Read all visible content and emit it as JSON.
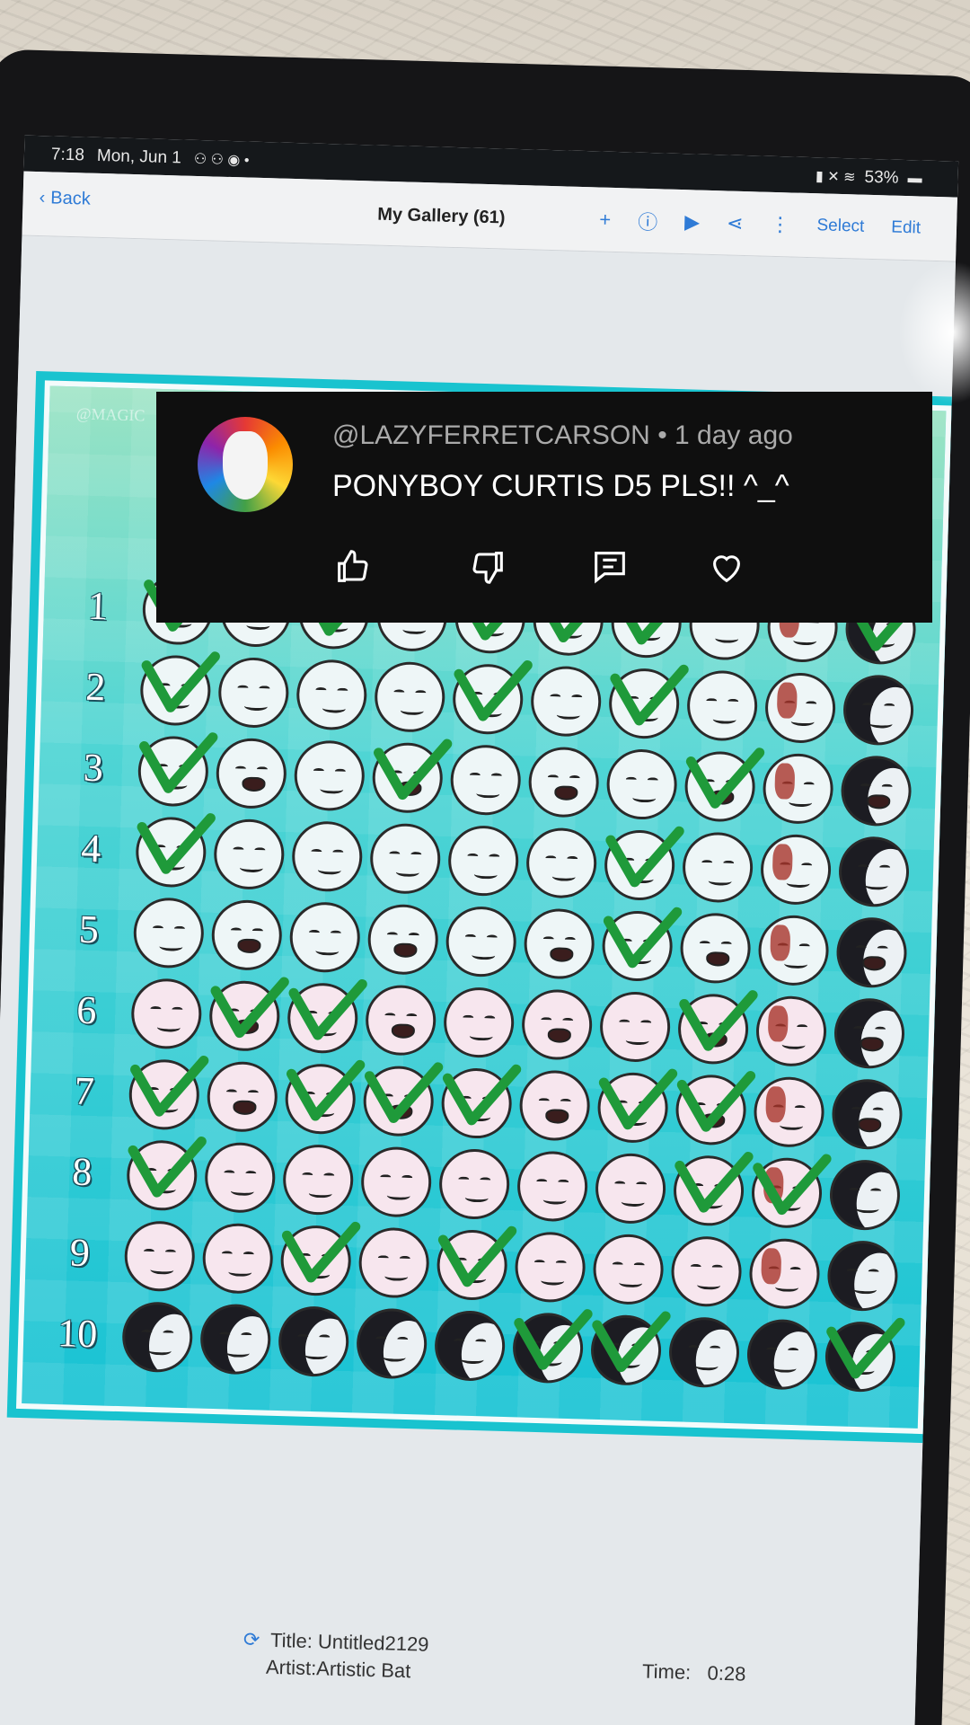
{
  "status_bar": {
    "time": "7:18",
    "date": "Mon, Jun 1",
    "battery": "53%"
  },
  "app_bar": {
    "back_label": "Back",
    "title": "My Gallery (61)",
    "select_label": "Select",
    "edit_label": "Edit",
    "icons": [
      "plus-icon",
      "info-icon",
      "play-icon",
      "share-icon",
      "more-icon"
    ]
  },
  "artwork": {
    "watermark": "@MAGIC",
    "row_numbers": [
      "1",
      "2",
      "3",
      "4",
      "5",
      "6",
      "7",
      "8",
      "9",
      "10"
    ]
  },
  "comment": {
    "handle": "@LAZYFERRETCARSON",
    "age": "1 day ago",
    "text": "PONYBOY CURTIS D5 PLS!! ^_^",
    "actions": [
      "like-icon",
      "dislike-icon",
      "reply-icon",
      "heart-icon"
    ]
  },
  "caption": {
    "title_label": "Title:",
    "title": "Untitled2129",
    "artist_label": "Artist:",
    "artist": "Artistic Bat",
    "time_label": "Time:",
    "time": "0:28"
  },
  "colors": {
    "accent": "#2f7bd6",
    "check": "#1f9a3a",
    "art_bg": "#19c3cf"
  }
}
